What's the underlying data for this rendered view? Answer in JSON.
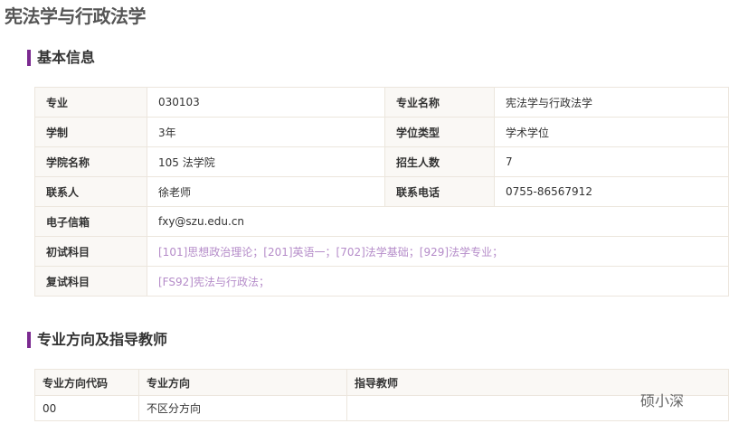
{
  "title": "宪法学与行政法学",
  "section1": "基本信息",
  "info": {
    "major_label": "专业",
    "major": "030103",
    "major_name_label": "专业名称",
    "major_name": "宪法学与行政法学",
    "duration_label": "学制",
    "duration": "3年",
    "degree_type_label": "学位类型",
    "degree_type": "学术学位",
    "college_label": "学院名称",
    "college": "105 法学院",
    "enroll_label": "招生人数",
    "enroll": "7",
    "contact_label": "联系人",
    "contact": "徐老师",
    "phone_label": "联系电话",
    "phone": "0755-86567912",
    "email_label": "电子信箱",
    "email": "fxy@szu.edu.cn",
    "prelim_label": "初试科目",
    "prelim": "[101]思想政治理论；[201]英语一；[702]法学基础；[929]法学专业；",
    "retest_label": "复试科目",
    "retest": "[FS92]宪法与行政法；"
  },
  "section2": "专业方向及指导教师",
  "directions": {
    "headers": [
      "专业方向代码",
      "专业方向",
      "指导教师"
    ],
    "rows": [
      [
        "00",
        "不区分方向",
        ""
      ]
    ]
  },
  "watermark": "硕小深",
  "colors": {
    "accent": "#7b2a90",
    "link": "#b58cc9"
  }
}
